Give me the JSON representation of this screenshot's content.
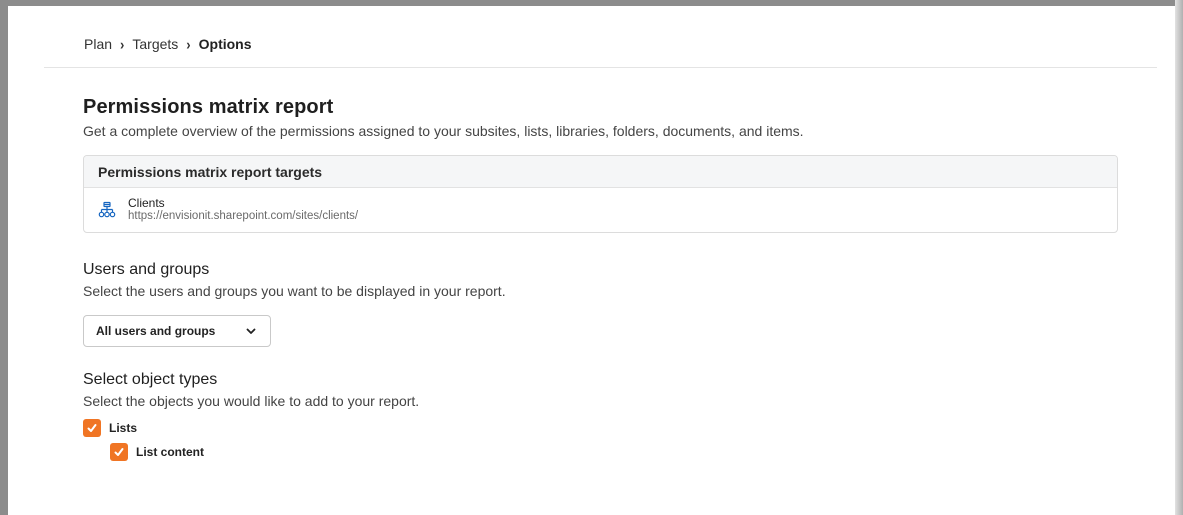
{
  "breadcrumb": {
    "items": [
      "Plan",
      "Targets",
      "Options"
    ]
  },
  "report": {
    "title": "Permissions matrix report",
    "description": "Get a complete overview of the permissions assigned to your subsites, lists, libraries, folders, documents, and items."
  },
  "targets": {
    "header": "Permissions matrix report targets",
    "items": [
      {
        "icon": "site-hierarchy-icon",
        "name": "Clients",
        "url": "https://envisionit.sharepoint.com/sites/clients/"
      }
    ]
  },
  "users_groups": {
    "title": "Users and groups",
    "description": "Select the users and groups you want to be displayed in your report.",
    "selected": "All users and groups"
  },
  "object_types": {
    "title": "Select object types",
    "description": "Select the objects you would like to add to your report.",
    "options": [
      {
        "label": "Lists",
        "checked": true
      },
      {
        "label": "List content",
        "checked": true
      }
    ]
  },
  "colors": {
    "accent": "#f07524"
  }
}
